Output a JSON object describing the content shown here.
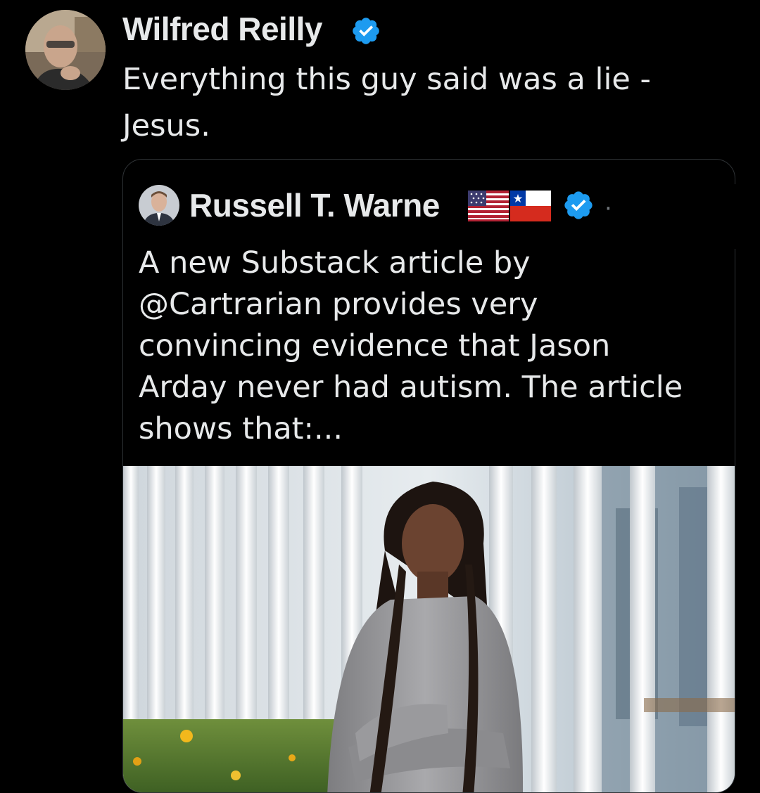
{
  "tweet": {
    "author": {
      "name": "Wilfred Reilly",
      "verified": true
    },
    "text": "Everything this guy said was a lie -\nJesus."
  },
  "quoted_tweet": {
    "author": {
      "name": "Russell T. Warne",
      "flags": [
        "us-flag",
        "chile-flag"
      ],
      "verified": true
    },
    "separator": "·",
    "text": "A new Substack article by\n@Cartrarian provides very\nconvincing evidence that Jason\nArday never had autism. The article\nshows that:..."
  },
  "colors": {
    "background": "#000000",
    "text": "#e7e9ea",
    "verified_badge": "#1d9bf0",
    "card_border": "#2f3336"
  },
  "icons": {
    "verified": "verified-badge-icon",
    "avatar_main": "profile-photo",
    "avatar_quote": "profile-photo",
    "media": "photo"
  }
}
